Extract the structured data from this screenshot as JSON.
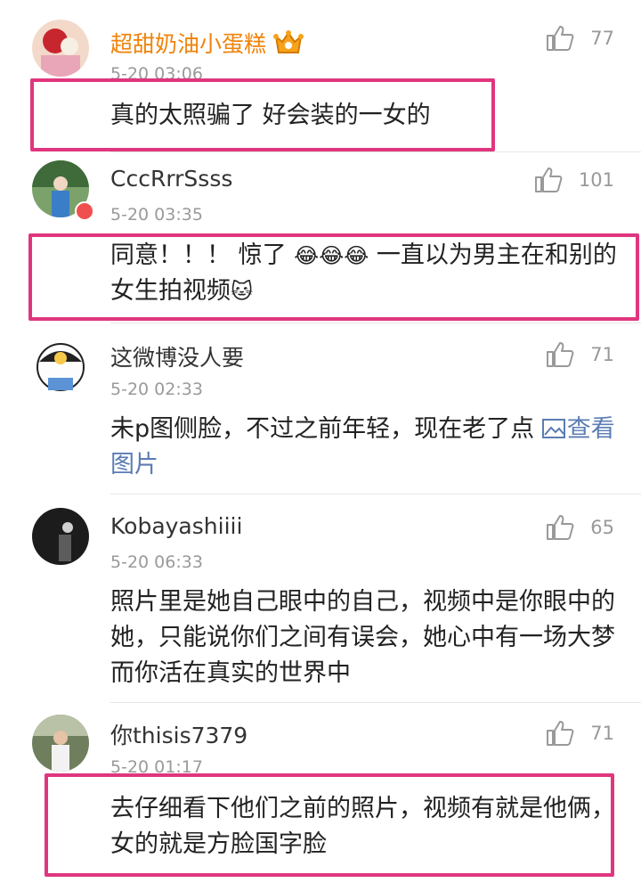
{
  "comments": [
    {
      "user": "超甜奶油小蛋糕",
      "time": "5-20 03:06",
      "likes": "77",
      "text": "真的太照骗了 好会装的一女的",
      "crown_icon": "vip-crown-icon"
    },
    {
      "user": "CccRrrSsss",
      "time": "5-20 03:35",
      "likes": "101",
      "text_main": "同意！！！ 惊了 ",
      "emoji": "😂😂😂",
      "text_tail": " 一直以为男主在和别的女生拍视频",
      "emoji2": "🐱"
    },
    {
      "user": "这微博没人要",
      "time": "5-20 02:33",
      "likes": "71",
      "text": "未p图侧脸，不过之前年轻，现在老了点 ",
      "link_icon": "image-icon",
      "link": "查看图片"
    },
    {
      "user": "Kobayashiiii",
      "time": "5-20 06:33",
      "likes": "65",
      "text": "照片里是她自己眼中的自己，视频中是你眼中的她，只能说你们之间有误会，她心中有一场大梦而你活在真实的世界中"
    },
    {
      "user": "你thisis7379",
      "time": "5-20 01:17",
      "likes": "71",
      "text": "去仔细看下他们之前的照片，视频有就是他俩，女的就是方脸国字脸"
    }
  ],
  "colors": {
    "highlight": "#e0367e",
    "vip_name": "#f0830a",
    "link": "#5b7cb3"
  }
}
